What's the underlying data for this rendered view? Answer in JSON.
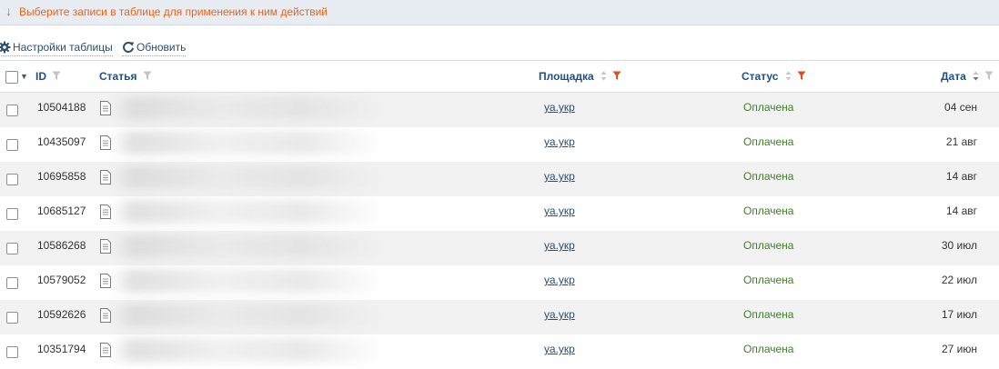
{
  "notice": {
    "arrow": "↓",
    "text": "Выберите записи в таблице для применения к ним действий"
  },
  "toolbar": {
    "settings_label": "Настройки таблицы",
    "refresh_label": "Обновить"
  },
  "table": {
    "columns": {
      "id": "ID",
      "article": "Статья",
      "site": "Площадка",
      "status": "Статус",
      "date": "Дата"
    },
    "rows": [
      {
        "id": "10504188",
        "site": "уа.укр",
        "status": "Оплачена",
        "date": "04 сен"
      },
      {
        "id": "10435097",
        "site": "уа.укр",
        "status": "Оплачена",
        "date": "21 авг"
      },
      {
        "id": "10695858",
        "site": "уа.укр",
        "status": "Оплачена",
        "date": "14 авг"
      },
      {
        "id": "10685127",
        "site": "уа.укр",
        "status": "Оплачена",
        "date": "14 авг"
      },
      {
        "id": "10586268",
        "site": "уа.укр",
        "status": "Оплачена",
        "date": "30 июл"
      },
      {
        "id": "10579052",
        "site": "уа.укр",
        "status": "Оплачена",
        "date": "22 июл"
      },
      {
        "id": "10592626",
        "site": "уа.укр",
        "status": "Оплачена",
        "date": "17 июл"
      },
      {
        "id": "10351794",
        "site": "уа.укр",
        "status": "Оплачена",
        "date": "27 июн"
      }
    ]
  },
  "colors": {
    "notice": "#e8641b",
    "header_text": "#1f4f82",
    "link": "#2a4f74",
    "status_paid": "#3f7f2a",
    "filter_active": "#e8491b",
    "filter_inactive": "#b5b5b5"
  }
}
